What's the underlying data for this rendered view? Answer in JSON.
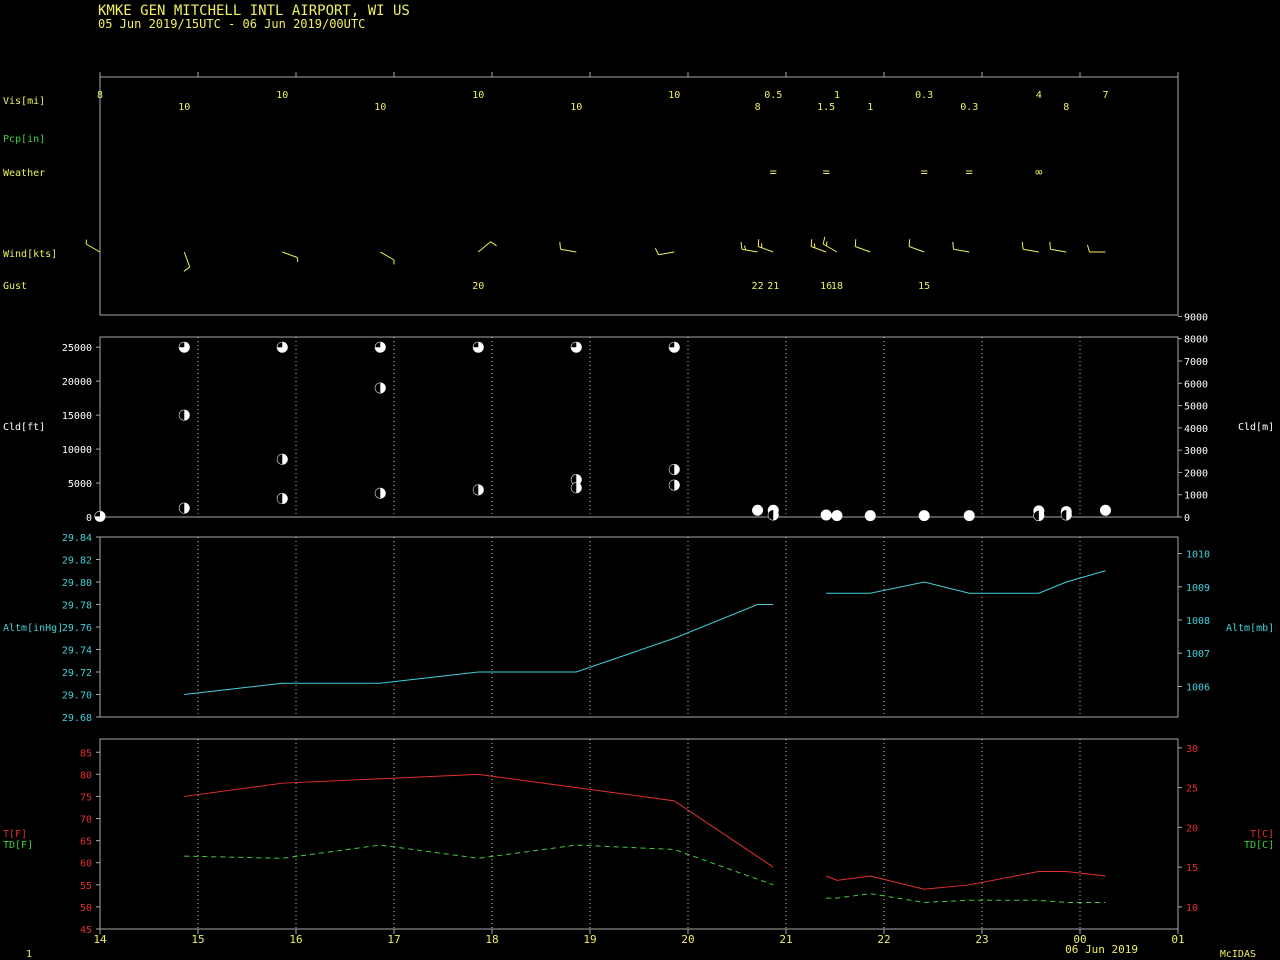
{
  "header": {
    "station_line": "KMKE   GEN MITCHELL INTL  AIRPORT, WI US",
    "period_line": "05 Jun 2019/15UTC - 06 Jun 2019/00UTC"
  },
  "colors": {
    "yellow": "#f0f060",
    "green": "#40d040",
    "cyan": "#40d0d8",
    "red": "#e03030",
    "frame": "#a8a8a8",
    "white": "#ffffff"
  },
  "labels": {
    "vis": "Vis[mi]",
    "pcp": "Pcp[in]",
    "weather": "Weather",
    "wind": "Wind[kts]",
    "gust": "Gust",
    "cld_left": "Cld[ft]",
    "cld_right": "Cld[m]",
    "altm_left": "Altm[inHg]",
    "altm_right": "Altm[mb]",
    "t_f": "T[F]",
    "td_f": "TD[F]",
    "t_c": "T[C]",
    "td_c": "TD[C]",
    "date": "06 Jun 2019",
    "footer_left": "1",
    "footer_right": "McIDAS"
  },
  "chart_data": {
    "type": "line",
    "x_axis": {
      "range": [
        14,
        25
      ],
      "tick_labels": [
        "14",
        "15",
        "16",
        "17",
        "18",
        "19",
        "20",
        "21",
        "22",
        "23",
        "00",
        "01"
      ]
    },
    "visibility": [
      {
        "x": 14.0,
        "label": "8"
      },
      {
        "x": 14.86,
        "label": "10"
      },
      {
        "x": 15.86,
        "label": "10"
      },
      {
        "x": 16.86,
        "label": "10"
      },
      {
        "x": 17.86,
        "label": "10"
      },
      {
        "x": 18.86,
        "label": "10"
      },
      {
        "x": 19.86,
        "label": "10"
      },
      {
        "x": 20.71,
        "label": "8"
      },
      {
        "x": 20.87,
        "label": "0.5"
      },
      {
        "x": 21.41,
        "label": "1.5"
      },
      {
        "x": 21.52,
        "label": "1"
      },
      {
        "x": 21.86,
        "label": "1"
      },
      {
        "x": 22.41,
        "label": "0.3"
      },
      {
        "x": 22.87,
        "label": "0.3"
      },
      {
        "x": 23.58,
        "label": "4"
      },
      {
        "x": 23.86,
        "label": "8"
      },
      {
        "x": 24.26,
        "label": "7"
      }
    ],
    "weather": [
      {
        "x": 20.87,
        "symbol": "="
      },
      {
        "x": 21.41,
        "symbol": "="
      },
      {
        "x": 22.41,
        "symbol": "="
      },
      {
        "x": 22.87,
        "symbol": "="
      },
      {
        "x": 23.58,
        "symbol": "∞"
      }
    ],
    "wind": [
      {
        "x": 14.0,
        "dir": 300,
        "kts": 5
      },
      {
        "x": 14.86,
        "dir": 160,
        "kts": 10
      },
      {
        "x": 15.86,
        "dir": 110,
        "kts": 5
      },
      {
        "x": 16.86,
        "dir": 120,
        "kts": 5
      },
      {
        "x": 17.86,
        "dir": 50,
        "kts": 10
      },
      {
        "x": 18.86,
        "dir": 280,
        "kts": 10
      },
      {
        "x": 19.86,
        "dir": 260,
        "kts": 10
      },
      {
        "x": 20.71,
        "dir": 280,
        "kts": 15
      },
      {
        "x": 20.87,
        "dir": 290,
        "kts": 15
      },
      {
        "x": 21.41,
        "dir": 290,
        "kts": 15
      },
      {
        "x": 21.52,
        "dir": 300,
        "kts": 15
      },
      {
        "x": 21.86,
        "dir": 290,
        "kts": 10
      },
      {
        "x": 22.41,
        "dir": 290,
        "kts": 10
      },
      {
        "x": 22.87,
        "dir": 280,
        "kts": 10
      },
      {
        "x": 23.58,
        "dir": 280,
        "kts": 10
      },
      {
        "x": 23.86,
        "dir": 280,
        "kts": 10
      },
      {
        "x": 24.26,
        "dir": 270,
        "kts": 10
      }
    ],
    "gust": [
      {
        "x": 17.86,
        "label": "20"
      },
      {
        "x": 20.71,
        "label": "22"
      },
      {
        "x": 20.87,
        "label": "21"
      },
      {
        "x": 21.41,
        "label": "16"
      },
      {
        "x": 21.52,
        "label": "18"
      },
      {
        "x": 22.41,
        "label": "15"
      }
    ],
    "clouds": {
      "y_ft_range": [
        0,
        26500
      ],
      "y_ft_ticks": [
        0,
        5000,
        10000,
        15000,
        20000,
        25000
      ],
      "y_m_ticks": [
        0,
        1000,
        2000,
        3000,
        4000,
        5000,
        6000,
        7000,
        8000,
        9000
      ],
      "points": [
        {
          "x": 14.0,
          "ft": 100,
          "cover": "bkn"
        },
        {
          "x": 14.86,
          "ft": 25000,
          "cover": "bkn"
        },
        {
          "x": 14.86,
          "ft": 15000,
          "cover": "sct"
        },
        {
          "x": 14.86,
          "ft": 1300,
          "cover": "sct"
        },
        {
          "x": 15.86,
          "ft": 25000,
          "cover": "bkn"
        },
        {
          "x": 15.86,
          "ft": 8500,
          "cover": "sct"
        },
        {
          "x": 15.86,
          "ft": 2700,
          "cover": "sct"
        },
        {
          "x": 16.86,
          "ft": 25000,
          "cover": "bkn"
        },
        {
          "x": 16.86,
          "ft": 19000,
          "cover": "sct"
        },
        {
          "x": 16.86,
          "ft": 3500,
          "cover": "sct"
        },
        {
          "x": 17.86,
          "ft": 25000,
          "cover": "bkn"
        },
        {
          "x": 17.86,
          "ft": 4000,
          "cover": "sct"
        },
        {
          "x": 18.86,
          "ft": 25000,
          "cover": "bkn"
        },
        {
          "x": 18.86,
          "ft": 5500,
          "cover": "sct"
        },
        {
          "x": 18.86,
          "ft": 4300,
          "cover": "sct"
        },
        {
          "x": 19.86,
          "ft": 25000,
          "cover": "bkn"
        },
        {
          "x": 19.86,
          "ft": 7000,
          "cover": "sct"
        },
        {
          "x": 19.86,
          "ft": 4700,
          "cover": "sct"
        },
        {
          "x": 20.71,
          "ft": 1000,
          "cover": "ovc"
        },
        {
          "x": 20.87,
          "ft": 1000,
          "cover": "ovc"
        },
        {
          "x": 20.87,
          "ft": 300,
          "cover": "sct"
        },
        {
          "x": 21.41,
          "ft": 300,
          "cover": "ovc"
        },
        {
          "x": 21.52,
          "ft": 200,
          "cover": "ovc"
        },
        {
          "x": 21.86,
          "ft": 200,
          "cover": "ovc"
        },
        {
          "x": 22.41,
          "ft": 200,
          "cover": "ovc"
        },
        {
          "x": 22.87,
          "ft": 200,
          "cover": "ovc"
        },
        {
          "x": 23.58,
          "ft": 900,
          "cover": "ovc"
        },
        {
          "x": 23.58,
          "ft": 200,
          "cover": "sct"
        },
        {
          "x": 23.86,
          "ft": 800,
          "cover": "ovc"
        },
        {
          "x": 23.86,
          "ft": 300,
          "cover": "sct"
        },
        {
          "x": 24.26,
          "ft": 1000,
          "cover": "ovc"
        }
      ]
    },
    "altimeter": {
      "y_range": [
        29.68,
        29.84
      ],
      "y_ticks": [
        "29.68",
        "29.70",
        "29.72",
        "29.74",
        "29.76",
        "29.78",
        "29.80",
        "29.82",
        "29.84"
      ],
      "y_mb_ticks": [
        "1006",
        "1007",
        "1008",
        "1009",
        "1010"
      ],
      "segments": [
        [
          [
            14.86,
            29.7
          ],
          [
            15.86,
            29.71
          ],
          [
            16.86,
            29.71
          ],
          [
            17.86,
            29.72
          ],
          [
            18.86,
            29.72
          ],
          [
            19.86,
            29.75
          ],
          [
            20.71,
            29.78
          ],
          [
            20.87,
            29.78
          ]
        ],
        [
          [
            21.41,
            29.79
          ],
          [
            21.86,
            29.79
          ],
          [
            22.41,
            29.8
          ],
          [
            22.87,
            29.79
          ],
          [
            23.58,
            29.79
          ],
          [
            23.86,
            29.8
          ],
          [
            24.26,
            29.81
          ]
        ]
      ]
    },
    "temperature": {
      "y_range": [
        45,
        88
      ],
      "y_ticks": [
        "45",
        "50",
        "55",
        "60",
        "65",
        "70",
        "75",
        "80",
        "85"
      ],
      "y_c_ticks": [
        "10",
        "15",
        "20",
        "25",
        "30"
      ],
      "t_segments": [
        [
          [
            14.86,
            75
          ],
          [
            15.86,
            78
          ],
          [
            16.86,
            79
          ],
          [
            17.86,
            80
          ],
          [
            18.86,
            77
          ],
          [
            19.86,
            74
          ],
          [
            20.87,
            59
          ]
        ],
        [
          [
            21.41,
            57
          ],
          [
            21.52,
            56
          ],
          [
            21.86,
            57
          ],
          [
            22.41,
            54
          ],
          [
            22.87,
            55
          ],
          [
            23.58,
            58
          ],
          [
            23.86,
            58
          ],
          [
            24.26,
            57
          ]
        ]
      ],
      "td_segments": [
        [
          [
            14.86,
            61.5
          ],
          [
            15.86,
            61
          ],
          [
            16.86,
            64
          ],
          [
            17.86,
            61
          ],
          [
            18.86,
            64
          ],
          [
            19.86,
            63
          ],
          [
            20.87,
            55
          ]
        ],
        [
          [
            21.41,
            52
          ],
          [
            21.52,
            52
          ],
          [
            21.86,
            53
          ],
          [
            22.41,
            51
          ],
          [
            22.87,
            51.5
          ],
          [
            23.58,
            51.5
          ],
          [
            23.86,
            51
          ],
          [
            24.26,
            51
          ]
        ]
      ]
    }
  }
}
